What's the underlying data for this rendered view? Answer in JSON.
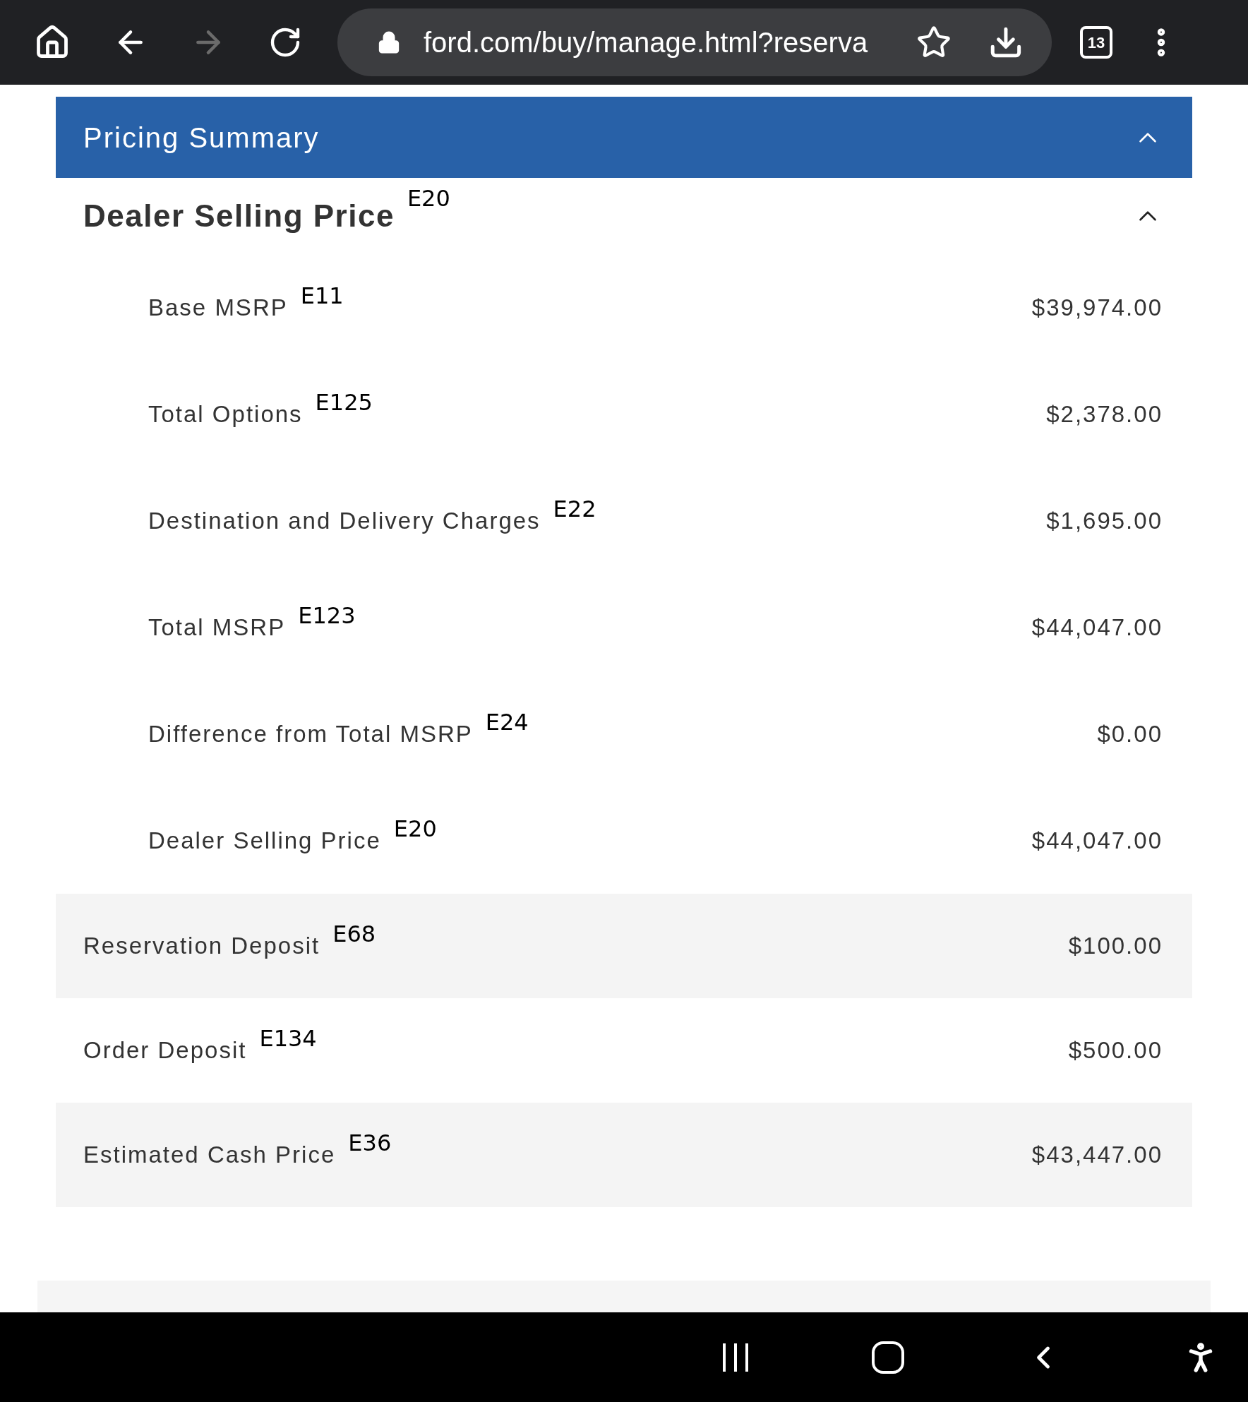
{
  "browser": {
    "url": "ford.com/buy/manage.html?reserva",
    "tab_count": "13",
    "forward_disabled": true
  },
  "pricing_summary": {
    "title": "Pricing Summary",
    "expanded": true,
    "section": {
      "title": "Dealer Selling Price",
      "note": "E20",
      "expanded": true,
      "rows": [
        {
          "label": "Base MSRP",
          "note": "E11",
          "amount": "$39,974.00"
        },
        {
          "label": "Total Options",
          "note": "E125",
          "amount": "$2,378.00"
        },
        {
          "label": "Destination and Delivery Charges",
          "note": "E22",
          "amount": "$1,695.00"
        },
        {
          "label": "Total MSRP",
          "note": "E123",
          "amount": "$44,047.00"
        },
        {
          "label": "Difference from Total MSRP",
          "note": "E24",
          "amount": "$0.00"
        },
        {
          "label": "Dealer Selling Price",
          "note": "E20",
          "amount": "$44,047.00"
        }
      ]
    },
    "totals": [
      {
        "label": "Reservation Deposit",
        "note": "E68",
        "amount": "$100.00"
      },
      {
        "label": "Order Deposit",
        "note": "E134",
        "amount": "$500.00"
      },
      {
        "label": "Estimated Cash Price",
        "note": "E36",
        "amount": "$43,447.00"
      }
    ]
  }
}
